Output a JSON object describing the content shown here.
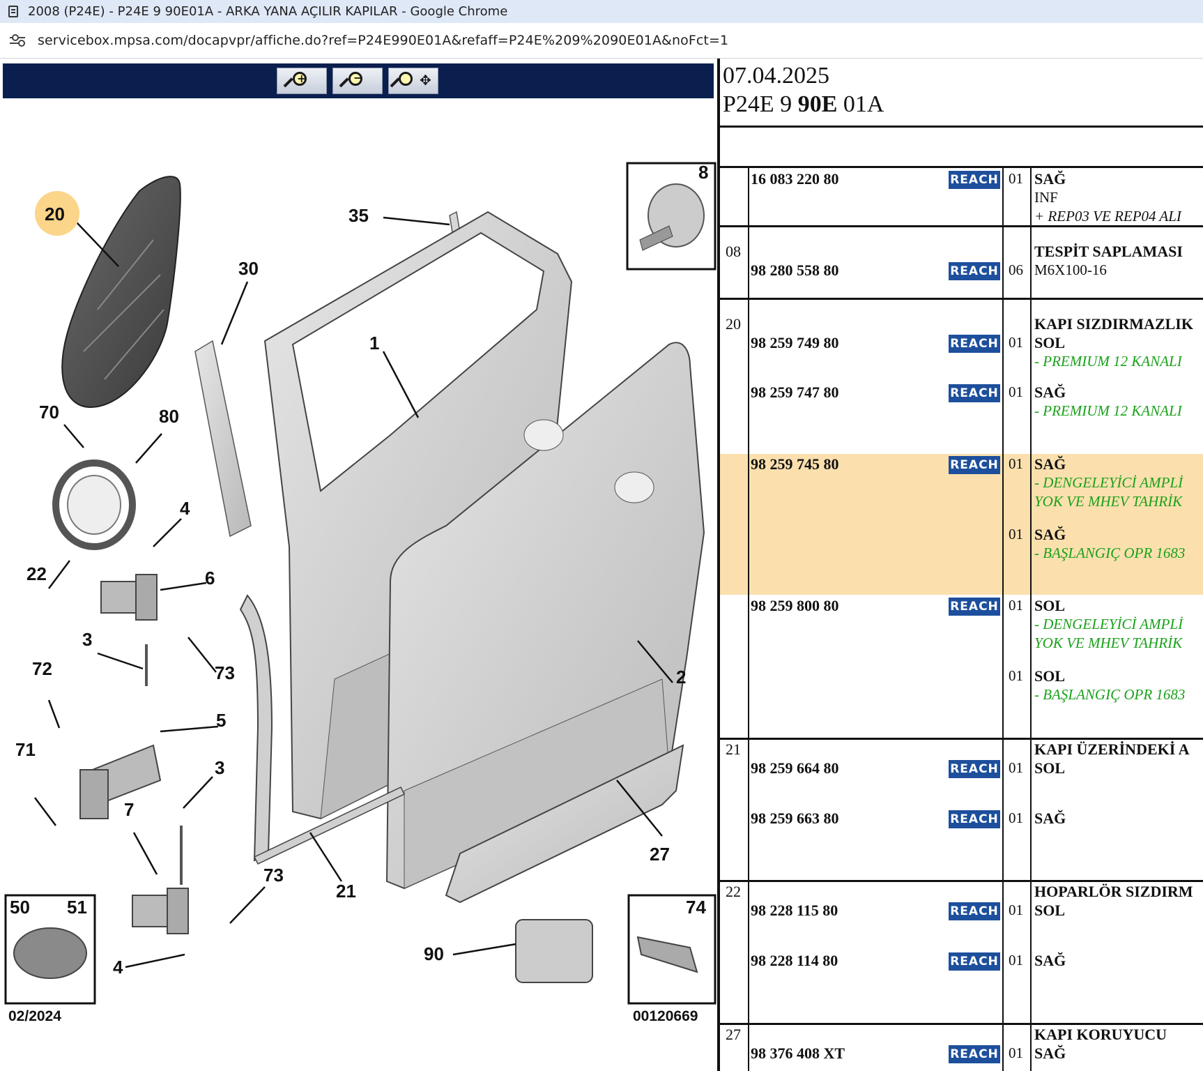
{
  "browser": {
    "window_title": "2008 (P24E) - P24E 9 90E01A - ARKA YANA AÇILIR KAPILAR - Google Chrome",
    "url": "servicebox.mpsa.com/docapvpr/affiche.do?ref=P24E990E01A&refaff=P24E%209%2090E01A&noFct=1"
  },
  "zoom_toolbar": {
    "buttons": [
      {
        "icon": "zoom-in-icon"
      },
      {
        "icon": "zoom-out-icon"
      },
      {
        "icon": "pan-zoom-icon"
      }
    ]
  },
  "diagram": {
    "callouts": [
      "20",
      "35",
      "30",
      "1",
      "8",
      "70",
      "80",
      "4",
      "22",
      "6",
      "3",
      "73",
      "72",
      "5",
      "71",
      "3",
      "7",
      "73",
      "4",
      "21",
      "27",
      "90",
      "2"
    ],
    "inset_left_labels": [
      "50",
      "51"
    ],
    "inset_left_date": "02/2024",
    "inset_right_label": "74",
    "inset_right_code": "00120669",
    "inset_top_label": "8"
  },
  "parts": {
    "date": "07.04.2025",
    "ref_prefix": "P24E 9 ",
    "ref_bold": "90E",
    "ref_suffix": " 01A",
    "reach_label": "REACH",
    "rows": [
      {
        "group": "",
        "pn": "16 083 220 80",
        "qty": "01",
        "title": "",
        "lines": [
          {
            "t": "SAĞ",
            "s": "title"
          },
          {
            "t": "INF",
            "s": "plain"
          },
          {
            "t": "+ REP03 VE REP04 ALI",
            "s": "note"
          }
        ]
      },
      {
        "group": "08",
        "pn": "98 280 558 80",
        "qty": "06",
        "title": "TESPİT SAPLAMASI",
        "lines": [
          {
            "t": "M6X100-16",
            "s": "plain"
          }
        ]
      },
      {
        "group": "20",
        "pn": "98 259 749 80",
        "qty": "01",
        "title": "KAPI SIZDIRMAZLIK",
        "lines": [
          {
            "t": "SOL",
            "s": "title"
          },
          {
            "t": "- PREMIUM 12 KANALI",
            "s": "green"
          }
        ]
      },
      {
        "group": "",
        "pn": "98 259 747 80",
        "qty": "01",
        "title": "",
        "lines": [
          {
            "t": "SAĞ",
            "s": "title"
          },
          {
            "t": "- PREMIUM 12 KANALI",
            "s": "green"
          }
        ]
      },
      {
        "group": "",
        "pn": "98 259 745 80",
        "qty": "01",
        "title": "",
        "lines": [
          {
            "t": "SAĞ",
            "s": "title"
          },
          {
            "t": "- DENGELEYİCİ AMPLİ",
            "s": "green"
          },
          {
            "t": "YOK VE MHEV TAHRİK",
            "s": "green"
          }
        ]
      },
      {
        "group": "",
        "pn": "",
        "qty": "01",
        "title": "",
        "lines": [
          {
            "t": "SAĞ",
            "s": "title"
          },
          {
            "t": "- BAŞLANGIÇ OPR 1683",
            "s": "green"
          }
        ]
      },
      {
        "group": "",
        "pn": "98 259 800 80",
        "qty": "01",
        "title": "",
        "lines": [
          {
            "t": "SOL",
            "s": "title"
          },
          {
            "t": "- DENGELEYİCİ AMPLİ",
            "s": "green"
          },
          {
            "t": "YOK VE MHEV TAHRİK",
            "s": "green"
          }
        ]
      },
      {
        "group": "",
        "pn": "",
        "qty": "01",
        "title": "",
        "lines": [
          {
            "t": "SOL",
            "s": "title"
          },
          {
            "t": "- BAŞLANGIÇ OPR 1683",
            "s": "green"
          }
        ]
      },
      {
        "group": "21",
        "pn": "98 259 664 80",
        "qty": "01",
        "title": "KAPI ÜZERİNDEKİ A",
        "lines": [
          {
            "t": "SOL",
            "s": "title"
          }
        ]
      },
      {
        "group": "",
        "pn": "98 259 663 80",
        "qty": "01",
        "title": "",
        "lines": [
          {
            "t": "SAĞ",
            "s": "title"
          }
        ]
      },
      {
        "group": "22",
        "pn": "98 228 115 80",
        "qty": "01",
        "title": "HOPARLÖR SIZDIRM",
        "lines": [
          {
            "t": "SOL",
            "s": "title"
          }
        ]
      },
      {
        "group": "",
        "pn": "98 228 114 80",
        "qty": "01",
        "title": "",
        "lines": [
          {
            "t": "SAĞ",
            "s": "title"
          }
        ]
      },
      {
        "group": "27",
        "pn": "98 376 408 XT",
        "qty": "01",
        "title": "KAPI KORUYUCU",
        "lines": [
          {
            "t": "SAĞ",
            "s": "title"
          }
        ]
      }
    ]
  }
}
